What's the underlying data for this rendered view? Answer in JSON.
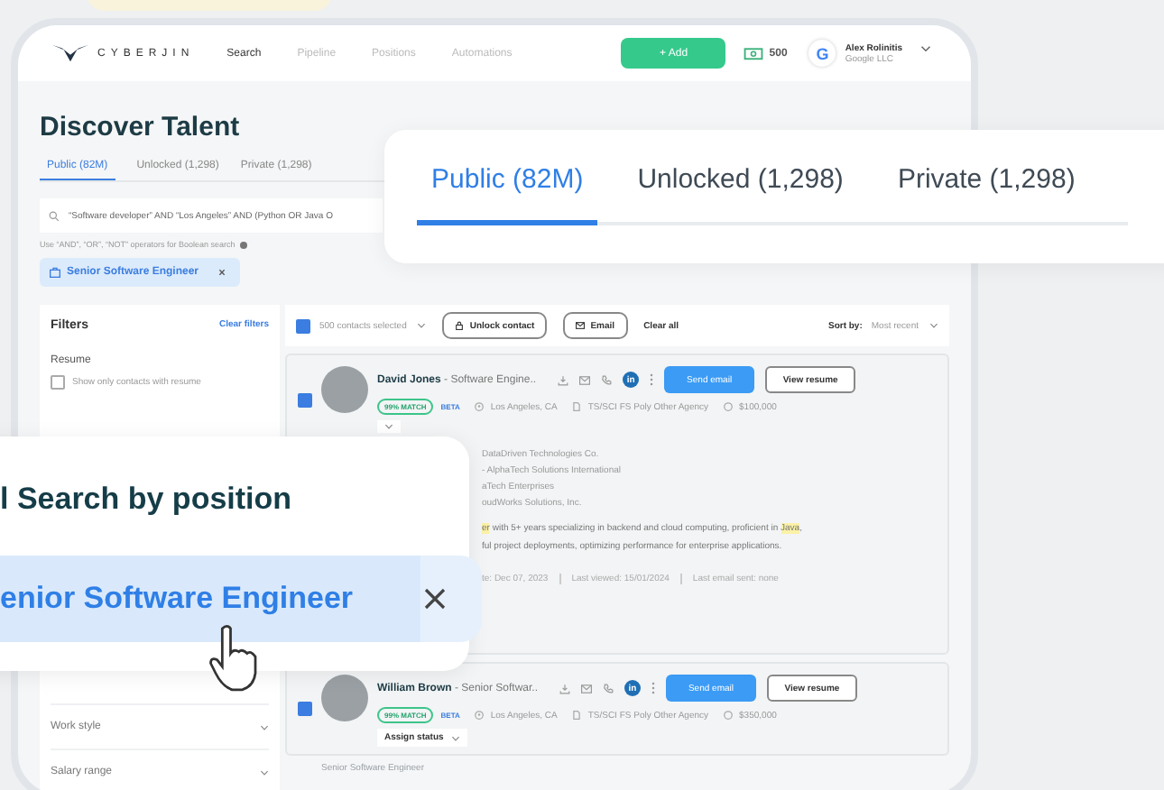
{
  "header": {
    "logo_text": "CYBERJIN",
    "nav": [
      {
        "label": "Search",
        "selected": true
      },
      {
        "label": "Pipeline",
        "selected": false
      },
      {
        "label": "Positions",
        "selected": false
      },
      {
        "label": "Automations",
        "selected": false
      }
    ],
    "add_button": "+ Add",
    "credits": "500",
    "user": {
      "avatar_letter": "G",
      "name": "Alex Rolinitis",
      "company": "Google LLC"
    }
  },
  "page_title": "Discover Talent",
  "tabs": [
    {
      "label": "Public (82M)",
      "selected": true
    },
    {
      "label": "Unlocked (1,298)",
      "selected": false
    },
    {
      "label": "Private (1,298)",
      "selected": false
    }
  ],
  "search": {
    "value": "“Software developer” AND “Los Angeles” AND (Python OR Java O",
    "hint": "Use “AND”, “OR”, “NOT” operators for Boolean search"
  },
  "chips": [
    {
      "label": "Senior Software Engineer"
    }
  ],
  "filters": {
    "title": "Filters",
    "clear": "Clear filters",
    "resume": {
      "title": "Resume",
      "label": "Show only contacts with resume",
      "checked": false
    },
    "collapsed": [
      {
        "title": "Work style"
      },
      {
        "title": "Salary range"
      }
    ]
  },
  "toolbar": {
    "selection": {
      "label": "500 contacts selected",
      "checked": true
    },
    "unlock": "Unlock contact",
    "email": "Email",
    "clear_all": "Clear all",
    "sort_label": "Sort by:",
    "sort_value": "Most recent"
  },
  "contacts": [
    {
      "name": "David Jones",
      "title": " - Software Engine..",
      "checked": true,
      "match": "99% MATCH",
      "beta": "BETA",
      "location": "Los Angeles, CA",
      "clearance": "TS/SCI FS Poly Other Agency",
      "salary": "$100,000",
      "linkedin": "in",
      "send": "Send email",
      "view": "View resume",
      "companies": [
        "DataDriven Technologies Co.",
        "- AlphaTech Solutions International",
        "aTech Enterprises",
        "oudWorks Solutions, Inc."
      ],
      "summary": [
        [
          {
            "text": "er",
            "highlight": true
          },
          {
            "text": " with 5+ years specializing in backend and cloud computing, proficient in ",
            "highlight": false
          },
          {
            "text": "Java",
            "highlight": true
          },
          {
            "text": ",",
            "highlight": false
          }
        ],
        [
          {
            "text": "ful project deployments, optimizing performance for enterprise applications.",
            "highlight": false
          }
        ]
      ],
      "meta": [
        "te: Dec 07, 2023",
        "Last viewed: 15/01/2024",
        "Last email sent: none"
      ]
    },
    {
      "name": "William Brown",
      "title": " - Senior Softwar..",
      "checked": true,
      "match": "99% MATCH",
      "beta": "BETA",
      "location": "Los Angeles, CA",
      "clearance": "TS/SCI FS Poly Other Agency",
      "salary": "$350,000",
      "linkedin": "in",
      "send": "Send email",
      "view": "View resume",
      "assign": "Assign status"
    }
  ],
  "footer_text": "Senior Software Engineer",
  "overlay_tabs": [
    {
      "label": "Public (82M)",
      "selected": true
    },
    {
      "label": "Unlocked (1,298)",
      "selected": false
    },
    {
      "label": "Private (1,298)",
      "selected": false
    }
  ],
  "overlay_position": {
    "title": "l Search by position",
    "value": "enior Software Engineer"
  }
}
